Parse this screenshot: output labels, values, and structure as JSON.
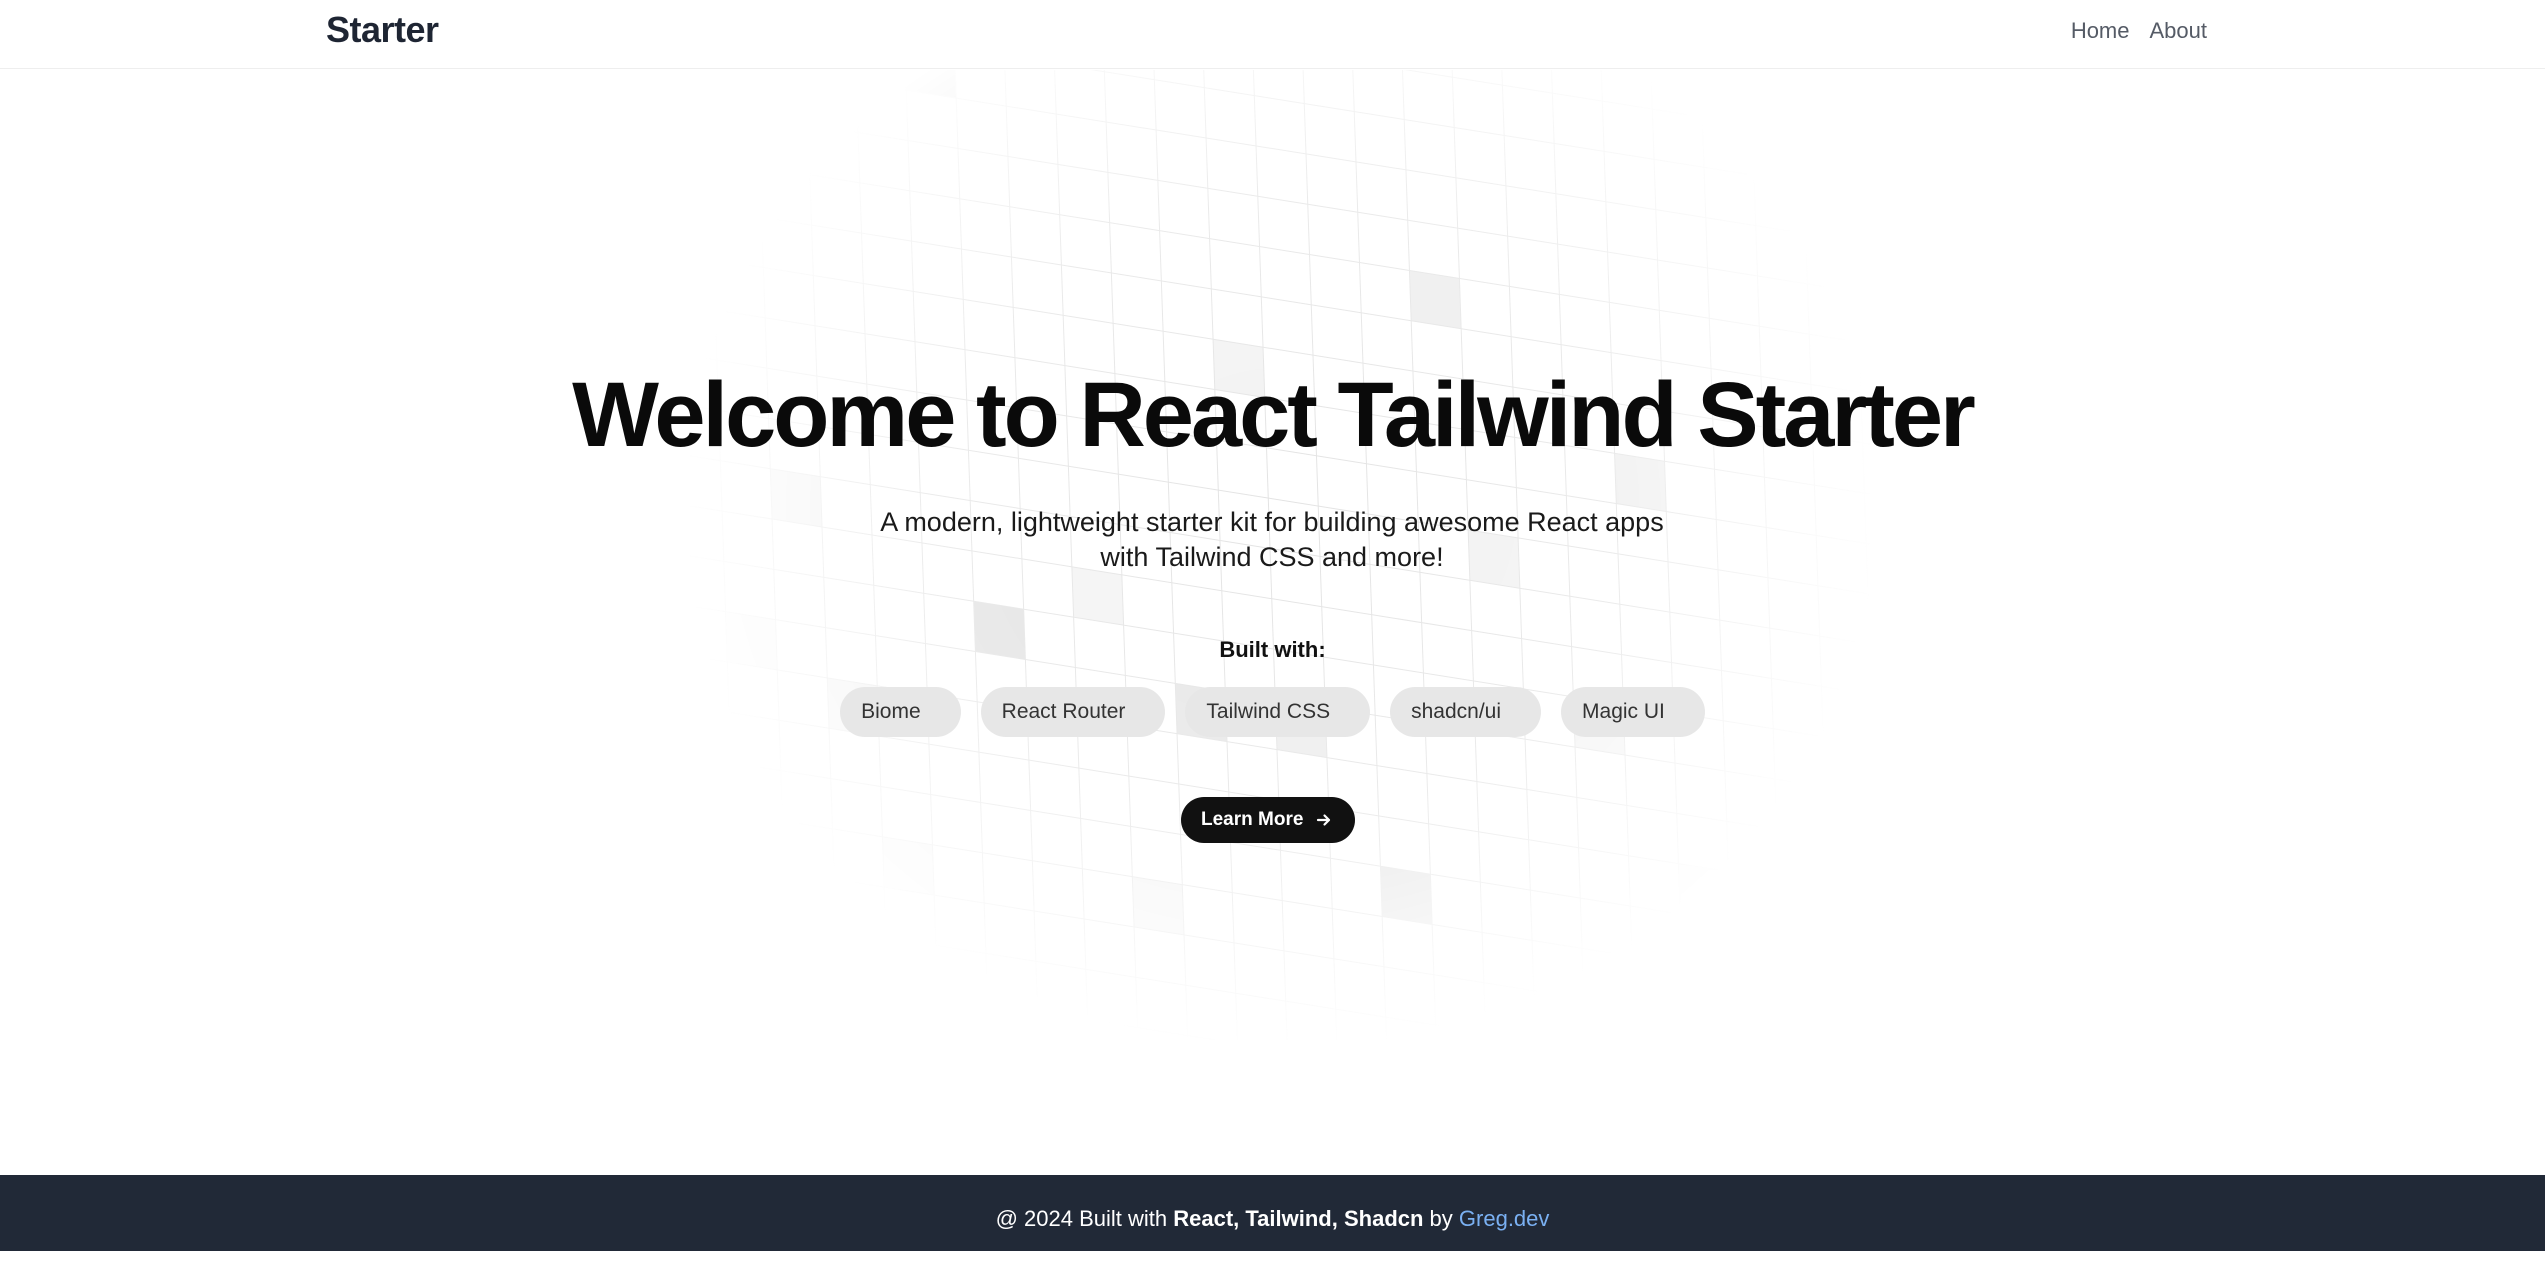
{
  "header": {
    "brand": "Starter",
    "nav": [
      {
        "label": "Home"
      },
      {
        "label": "About"
      }
    ]
  },
  "hero": {
    "title": "Welcome to React Tailwind Starter",
    "subtitle_line1": "A modern, lightweight starter kit for building awesome React apps",
    "subtitle_line2": "with Tailwind CSS and more!",
    "built_with_label": "Built with:",
    "tech": [
      "Biome",
      "React Router",
      "Tailwind CSS",
      "shadcn/ui",
      "Magic UI"
    ],
    "cta_label": "Learn More",
    "cta_icon": "arrow-right-icon"
  },
  "footer": {
    "prefix": "@ 2024 Built with ",
    "stack": "React, Tailwind, Shadcn",
    "by": " by ",
    "author": "Greg.dev"
  },
  "colors": {
    "footer_bg": "#212937",
    "footer_link": "#7ab0f2",
    "cta_bg": "#111111",
    "pill_bg": "#e7e7e7",
    "brand": "#1e2533"
  }
}
